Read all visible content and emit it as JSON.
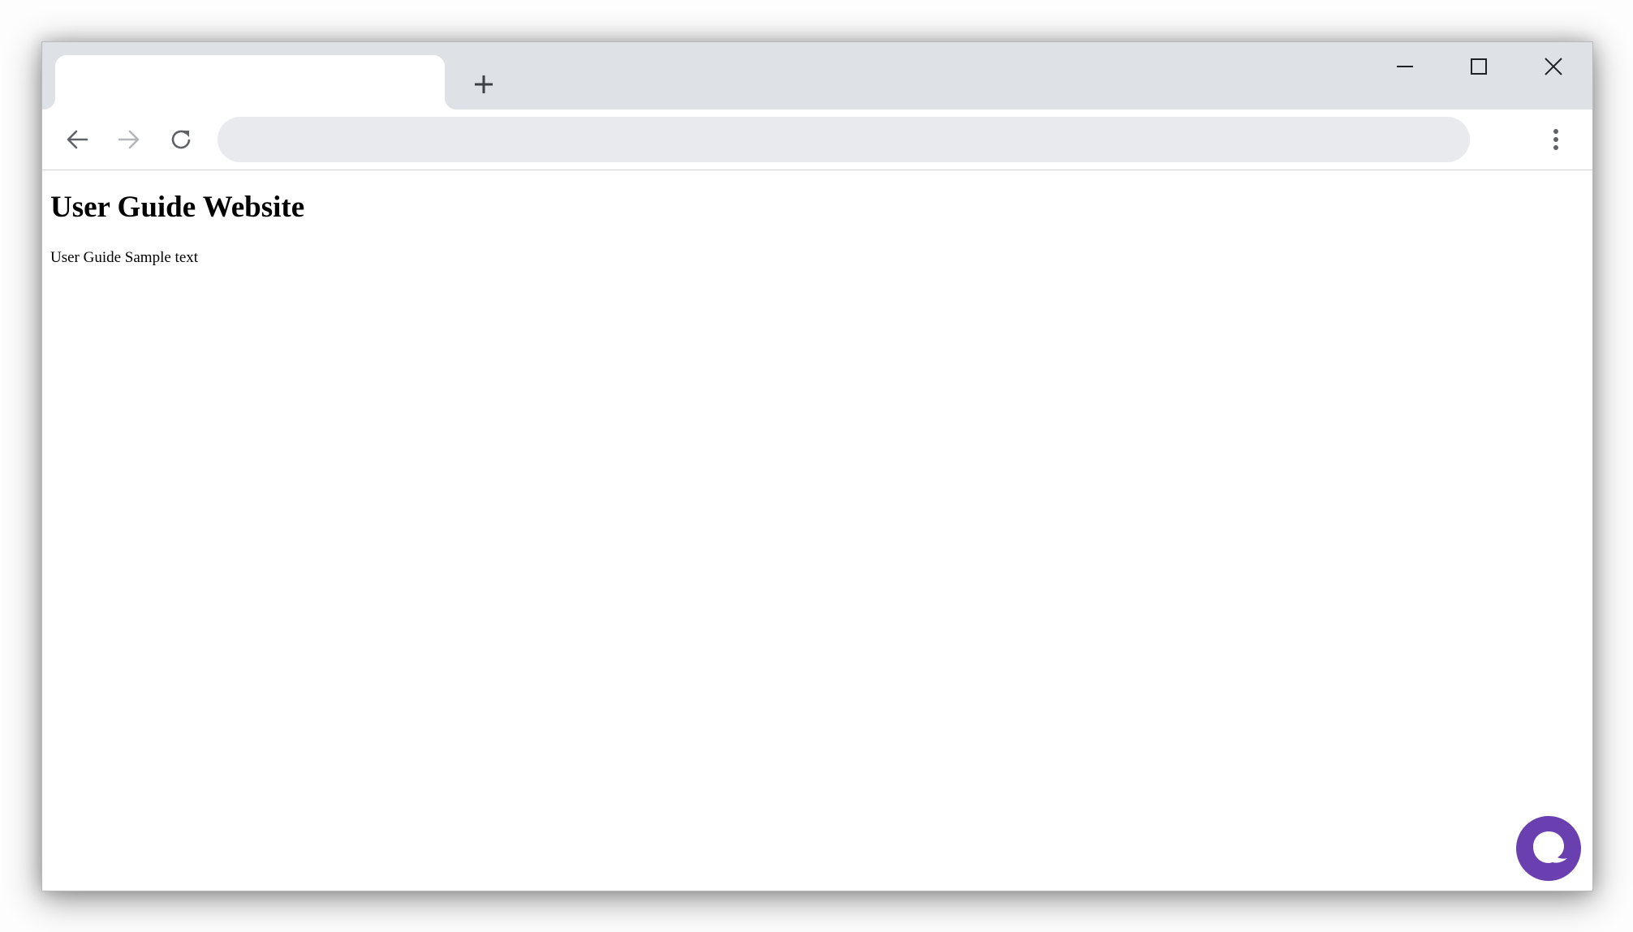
{
  "browser": {
    "tab": {
      "title": ""
    },
    "new_tab_icon": "plus-icon",
    "window_controls": [
      "minimize-icon",
      "maximize-icon",
      "close-icon"
    ],
    "toolbar": {
      "back_icon": "arrow-left-icon",
      "forward_icon": "arrow-right-icon",
      "reload_icon": "reload-icon",
      "address_value": "",
      "menu_icon": "more-vertical-icon"
    }
  },
  "page": {
    "heading": "User Guide Website",
    "body_text": "User Guide Sample text"
  },
  "chat_widget": {
    "icon": "chat-bubble-icon",
    "color": "#6a3fb0"
  }
}
